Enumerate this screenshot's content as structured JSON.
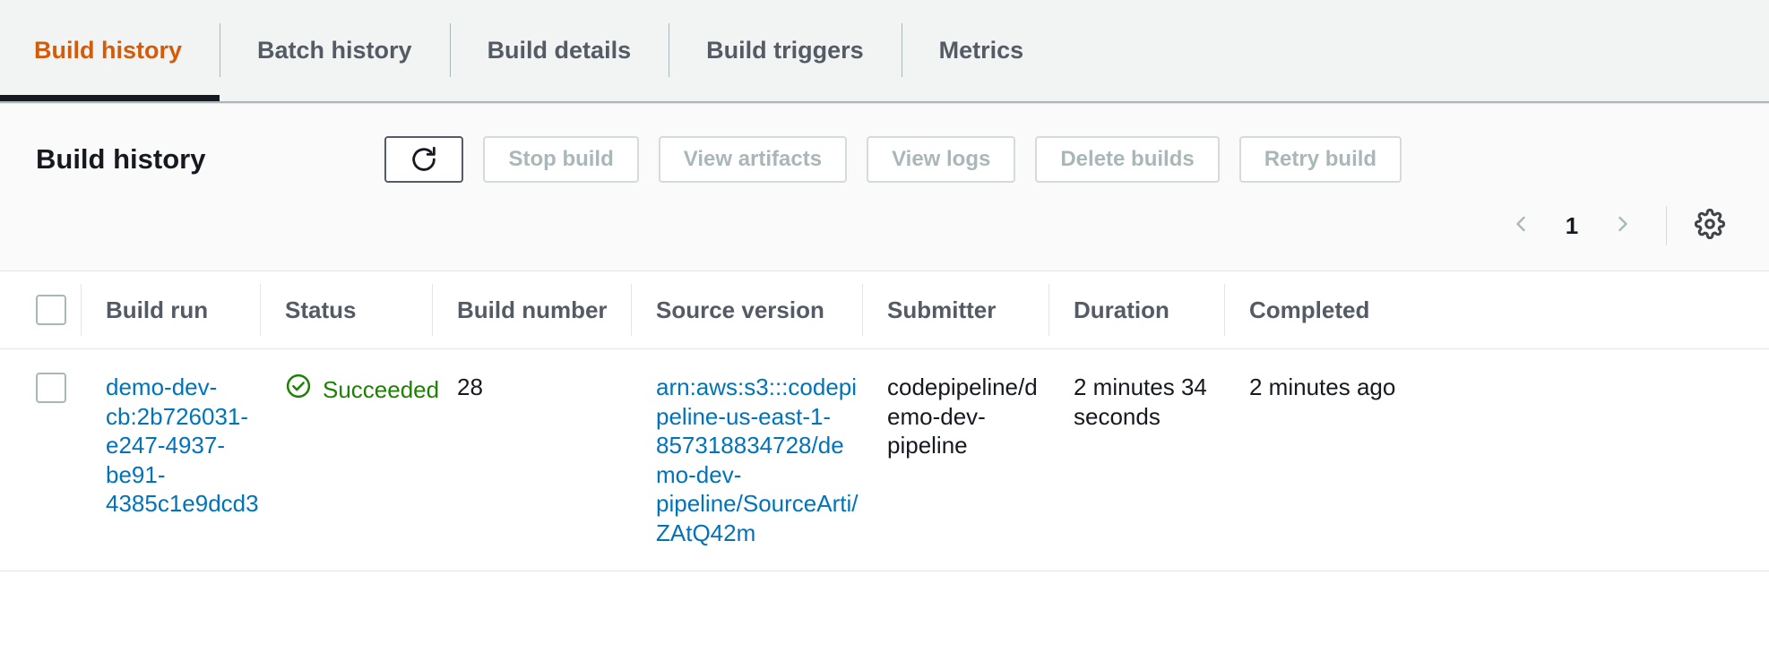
{
  "tabs": [
    {
      "label": "Build history",
      "active": true
    },
    {
      "label": "Batch history",
      "active": false
    },
    {
      "label": "Build details",
      "active": false
    },
    {
      "label": "Build triggers",
      "active": false
    },
    {
      "label": "Metrics",
      "active": false
    }
  ],
  "panel": {
    "title": "Build history",
    "refresh_icon": "refresh-icon",
    "buttons": [
      {
        "label": "Stop build",
        "disabled": true
      },
      {
        "label": "View artifacts",
        "disabled": true
      },
      {
        "label": "View logs",
        "disabled": true
      },
      {
        "label": "Delete builds",
        "disabled": true
      },
      {
        "label": "Retry build",
        "disabled": true
      }
    ]
  },
  "pagination": {
    "prev_icon": "chevron-left-icon",
    "next_icon": "chevron-right-icon",
    "page": "1",
    "settings_icon": "gear-icon"
  },
  "table": {
    "columns": [
      "Build run",
      "Status",
      "Build number",
      "Source version",
      "Submitter",
      "Duration",
      "Completed"
    ],
    "rows": [
      {
        "build_run": "demo-dev-cb:2b726031-e247-4937-be91-4385c1e9dcd3",
        "status": "Succeeded",
        "status_icon": "check-circle-icon",
        "build_number": "28",
        "source_version": "arn:aws:s3:::codepipeline-us-east-1-857318834728/demo-dev-pipeline/SourceArti/ZAtQ42m",
        "submitter": "codepipeline/demo-dev-pipeline",
        "duration": "2 minutes 34 seconds",
        "completed": "2 minutes ago"
      }
    ]
  },
  "colors": {
    "accent_orange": "#d45b07",
    "link_blue": "#0073bb",
    "success_green": "#1d8102",
    "disabled_grey": "#aab7b8"
  }
}
